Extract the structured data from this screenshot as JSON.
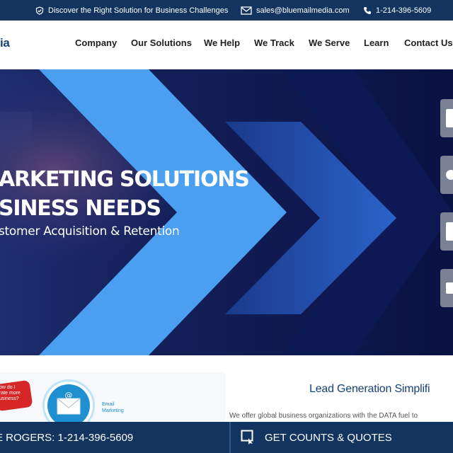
{
  "topbar": {
    "tagline": "Discover the Right Solution for Business Challenges",
    "email": "sales@bluemailmedia.com",
    "phone": "1-214-396-5609"
  },
  "logo": {
    "text": "ia"
  },
  "nav": {
    "items": [
      "Company",
      "Our Solutions",
      "We Help",
      "We Track",
      "We Serve",
      "Learn",
      "Contact Us"
    ]
  },
  "hero": {
    "title_line1": "ARKETING SOLUTIONS",
    "title_line2": "SINESS NEEDS",
    "subtitle": "stomer Acquisition & Retention"
  },
  "promo": {
    "speech_text": "ow do I\nrate more\nusiness?",
    "email_label": "Email\nMarketing"
  },
  "lead": {
    "title": "Lead Generation Simplifi",
    "text": "We offer global business organizations with the DATA fuel to"
  },
  "bottombar": {
    "call": "E ROGERS: 1-214-396-5609",
    "quote": "GET COUNTS & QUOTES"
  },
  "colors": {
    "topbar": "#12345e",
    "hero_bg": "#0d1849",
    "chevron": "#4a9ff0",
    "accent": "#15427a"
  }
}
